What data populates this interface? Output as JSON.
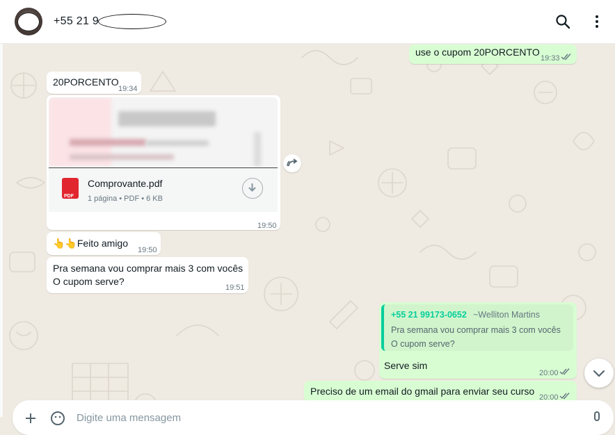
{
  "header": {
    "contact_name": "+55 21 9",
    "icons": [
      "search-icon",
      "menu-icon"
    ]
  },
  "messages": [
    {
      "direction": "out",
      "text": "use o cupom 20PORCENTO",
      "time": "19:33",
      "status": "read"
    },
    {
      "direction": "in",
      "text": "20PORCENTO",
      "time": "19:34"
    },
    {
      "direction": "in",
      "type": "document",
      "file_name": "Comprovante.pdf",
      "file_meta": "1 página • PDF • 6 KB",
      "file_icon_label": "PDF",
      "time": "19:50"
    },
    {
      "direction": "in",
      "text": "👆👆Feito amigo",
      "time": "19:50"
    },
    {
      "direction": "in",
      "lines": [
        "Pra semana vou comprar mais 3 com vocês",
        "O cupom serve?"
      ],
      "time": "19:51"
    },
    {
      "direction": "out",
      "quote": {
        "author": "+55 21 99173-0652",
        "pushname": "~Welliton Martins",
        "lines": [
          "Pra semana vou comprar mais 3 com vocês",
          "O cupom serve?"
        ]
      },
      "text": "Serve sim",
      "time": "20:00",
      "status": "read"
    },
    {
      "direction": "out",
      "text": "Preciso de um email do gmail para enviar seu curso",
      "time": "20:00",
      "status": "read"
    }
  ],
  "compose": {
    "placeholder": "Digite uma mensagem",
    "icons": [
      "plus-icon",
      "emoji-icon",
      "microphone-icon"
    ]
  },
  "colors": {
    "chat_bg": "#efeae2",
    "outgoing": "#d9fdd3",
    "incoming": "#ffffff",
    "accent": "#06cf9c",
    "read_ticks": "#667781"
  }
}
